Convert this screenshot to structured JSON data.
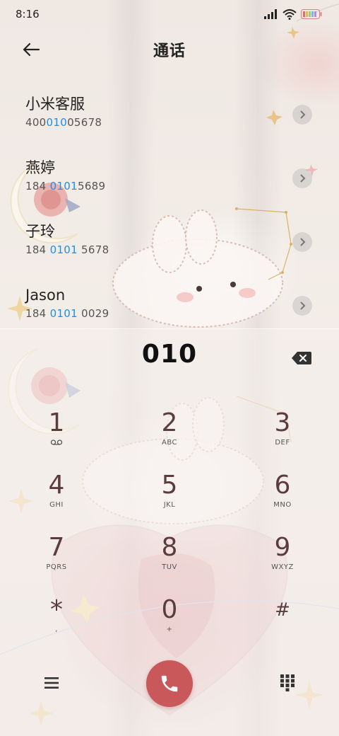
{
  "status_bar": {
    "time": "8:16"
  },
  "header": {
    "title": "通话"
  },
  "contacts": [
    {
      "name": "小米客服",
      "number_pre": "400",
      "number_match": "010",
      "number_post": "05678"
    },
    {
      "name": "燕婷",
      "number_pre": "184 ",
      "number_match": "0101",
      "number_post": "5689"
    },
    {
      "name": "子玲",
      "number_pre": "184 ",
      "number_match": "0101",
      "number_post": " 5678"
    },
    {
      "name": "Jason",
      "number_pre": "184 ",
      "number_match": "0101",
      "number_post": " 0029"
    }
  ],
  "dialer": {
    "input": "010",
    "keys": [
      {
        "digit": "1",
        "letters": ""
      },
      {
        "digit": "2",
        "letters": "ABC"
      },
      {
        "digit": "3",
        "letters": "DEF"
      },
      {
        "digit": "4",
        "letters": "GHI"
      },
      {
        "digit": "5",
        "letters": "JKL"
      },
      {
        "digit": "6",
        "letters": "MNO"
      },
      {
        "digit": "7",
        "letters": "PQRS"
      },
      {
        "digit": "8",
        "letters": "TUV"
      },
      {
        "digit": "9",
        "letters": "WXYZ"
      },
      {
        "digit": "*",
        "letters": ","
      },
      {
        "digit": "0",
        "letters": "+"
      },
      {
        "digit": "#",
        "letters": ""
      }
    ]
  },
  "icons": {
    "back": "arrow-left-icon",
    "delete": "backspace-icon",
    "menu": "menu-icon",
    "call": "phone-icon",
    "keypad": "dialpad-icon",
    "voicemail": "voicemail-icon"
  },
  "colors": {
    "highlight": "#1e8fe6",
    "call_button": "#c9585a",
    "digit": "#5a3c3c"
  }
}
